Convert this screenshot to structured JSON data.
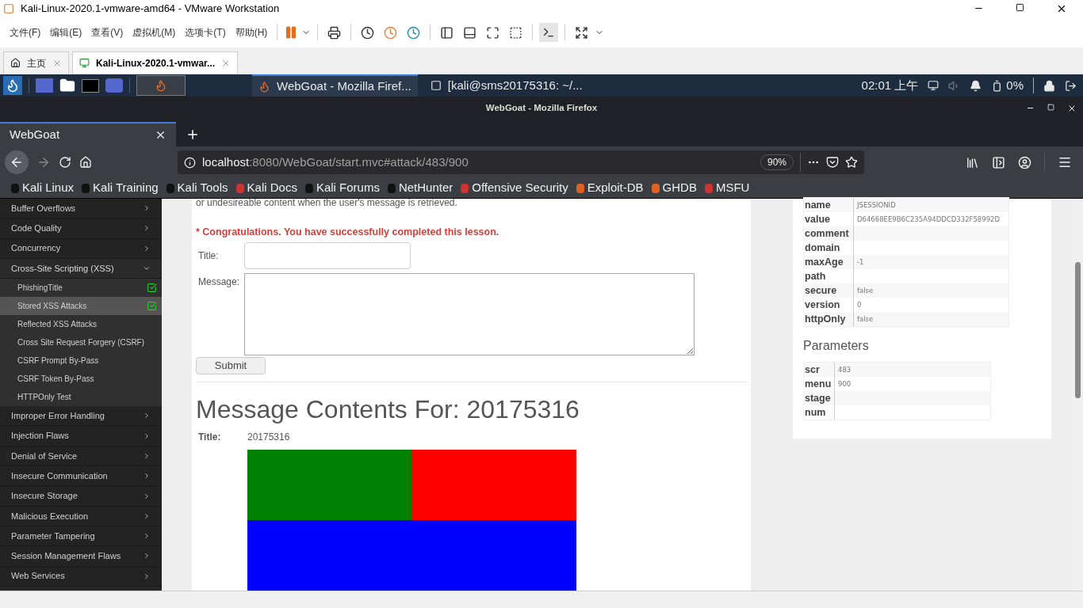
{
  "vmware": {
    "title": "Kali-Linux-2020.1-vmware-amd64 - VMware Workstation",
    "menu": [
      "文件(F)",
      "编辑(E)",
      "查看(V)",
      "虚拟机(M)",
      "选项卡(T)",
      "帮助(H)"
    ],
    "tabs": [
      {
        "label": "主页",
        "selected": false
      },
      {
        "label": "Kali-Linux-2020.1-vmwar...",
        "selected": true
      }
    ]
  },
  "kali_panel": {
    "windows": [
      {
        "label": "WebGoat - Mozilla Firef...",
        "selected": true
      },
      {
        "label": "[kali@sms20175316: ~/...",
        "selected": false
      }
    ],
    "clock": "02:01 上午",
    "battery": "0%"
  },
  "firefox": {
    "title": "WebGoat - Mozilla Firefox",
    "tab": "WebGoat",
    "url_host": "localhost",
    "url_rest": ":8080/WebGoat/start.mvc#attack/483/900",
    "zoom": "90%",
    "bookmarks": [
      "Kali Linux",
      "Kali Training",
      "Kali Tools",
      "Kali Docs",
      "Kali Forums",
      "NetHunter",
      "Offensive Security",
      "Exploit-DB",
      "GHDB",
      "MSFU"
    ]
  },
  "sidebar": {
    "items": [
      {
        "label": "Buffer Overflows",
        "expanded": false
      },
      {
        "label": "Code Quality",
        "expanded": false
      },
      {
        "label": "Concurrency",
        "expanded": false
      },
      {
        "label": "Cross-Site Scripting (XSS)",
        "expanded": true,
        "children": [
          {
            "label": "PhishingTitle",
            "selected": false,
            "completed": true
          },
          {
            "label": "Stored XSS Attacks",
            "selected": true,
            "completed": true
          },
          {
            "label": "Reflected XSS Attacks",
            "selected": false,
            "completed": false
          },
          {
            "label": "Cross Site Request Forgery (CSRF)",
            "selected": false,
            "completed": false
          },
          {
            "label": "CSRF Prompt By-Pass",
            "selected": false,
            "completed": false
          },
          {
            "label": "CSRF Token By-Pass",
            "selected": false,
            "completed": false
          },
          {
            "label": "HTTPOnly Test",
            "selected": false,
            "completed": false
          }
        ]
      },
      {
        "label": "Improper Error Handling",
        "expanded": false
      },
      {
        "label": "Injection Flaws",
        "expanded": false
      },
      {
        "label": "Denial of Service",
        "expanded": false
      },
      {
        "label": "Insecure Communication",
        "expanded": false
      },
      {
        "label": "Insecure Storage",
        "expanded": false
      },
      {
        "label": "Malicious Execution",
        "expanded": false
      },
      {
        "label": "Parameter Tampering",
        "expanded": false
      },
      {
        "label": "Session Management Flaws",
        "expanded": false
      },
      {
        "label": "Web Services",
        "expanded": false
      }
    ]
  },
  "lesson": {
    "intro": "or undesireable content when the user's message is retrieved.",
    "success": "* Congratulations. You have successfully completed this lesson.",
    "title_label": "Title:",
    "message_label": "Message:",
    "submit": "Submit",
    "heading": "Message Contents For: 20175316",
    "msg_title_label": "Title:",
    "msg_title": "20175316",
    "blocks": [
      {
        "color": "#008000"
      },
      {
        "color": "#ff0000"
      },
      {
        "color": "#0000ff"
      }
    ]
  },
  "cookie": [
    {
      "key": "name",
      "value": "JSESSIONID"
    },
    {
      "key": "value",
      "value": "D64668EE9B6C235A94DDCD332F58992D"
    },
    {
      "key": "comment"
    },
    {
      "key": "domain"
    },
    {
      "key": "maxAge",
      "value": "-1"
    },
    {
      "key": "path"
    },
    {
      "key": "secure",
      "value": "false"
    },
    {
      "key": "version",
      "value": "0"
    },
    {
      "key": "httpOnly",
      "value": "false"
    }
  ],
  "parameters": {
    "title": "Parameters",
    "rows": [
      {
        "key": "scr",
        "value": "483"
      },
      {
        "key": "menu",
        "value": "900"
      },
      {
        "key": "stage"
      },
      {
        "key": "num"
      }
    ]
  }
}
